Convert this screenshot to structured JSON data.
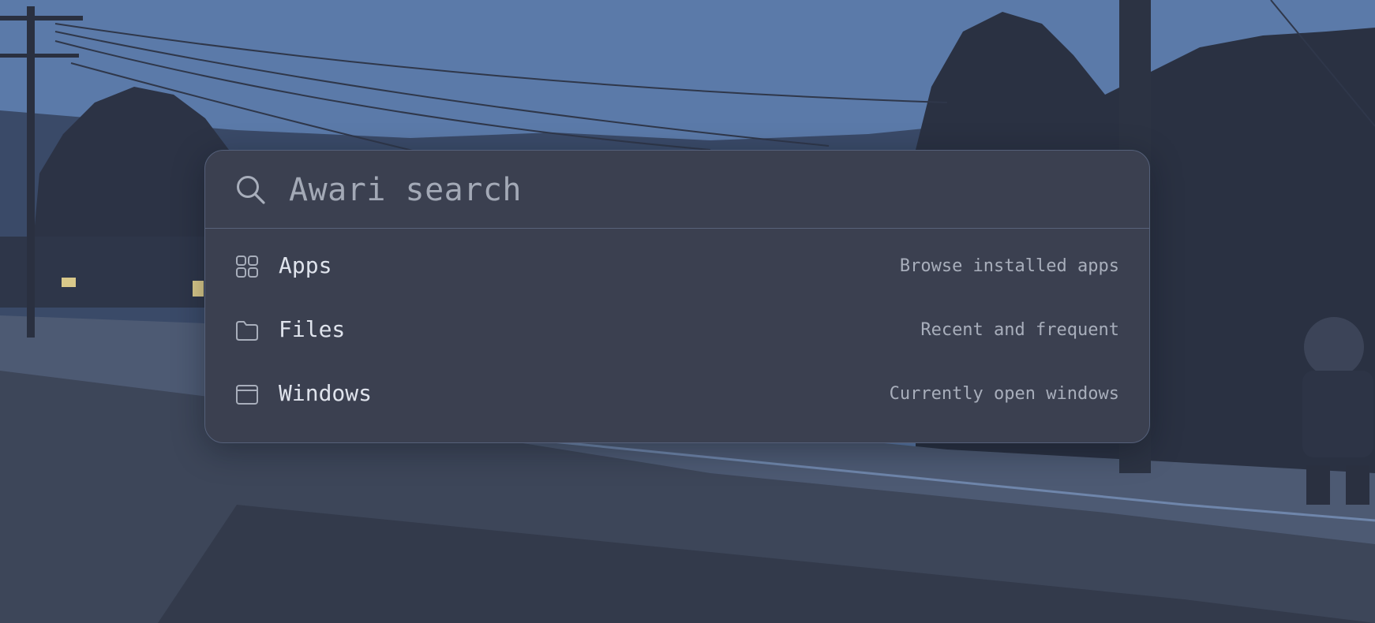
{
  "search": {
    "placeholder": "Awari search",
    "value": ""
  },
  "results": [
    {
      "icon": "grid-icon",
      "label": "Apps",
      "description": "Browse installed apps"
    },
    {
      "icon": "folder-icon",
      "label": "Files",
      "description": "Recent and frequent"
    },
    {
      "icon": "window-icon",
      "label": "Windows",
      "description": "Currently open windows"
    }
  ],
  "colors": {
    "panel_bg": "#3b4050",
    "panel_border": "#55607a",
    "label_text": "#dfe3ec",
    "secondary_text": "#a8aebb",
    "sky": "#5a7aa8"
  }
}
